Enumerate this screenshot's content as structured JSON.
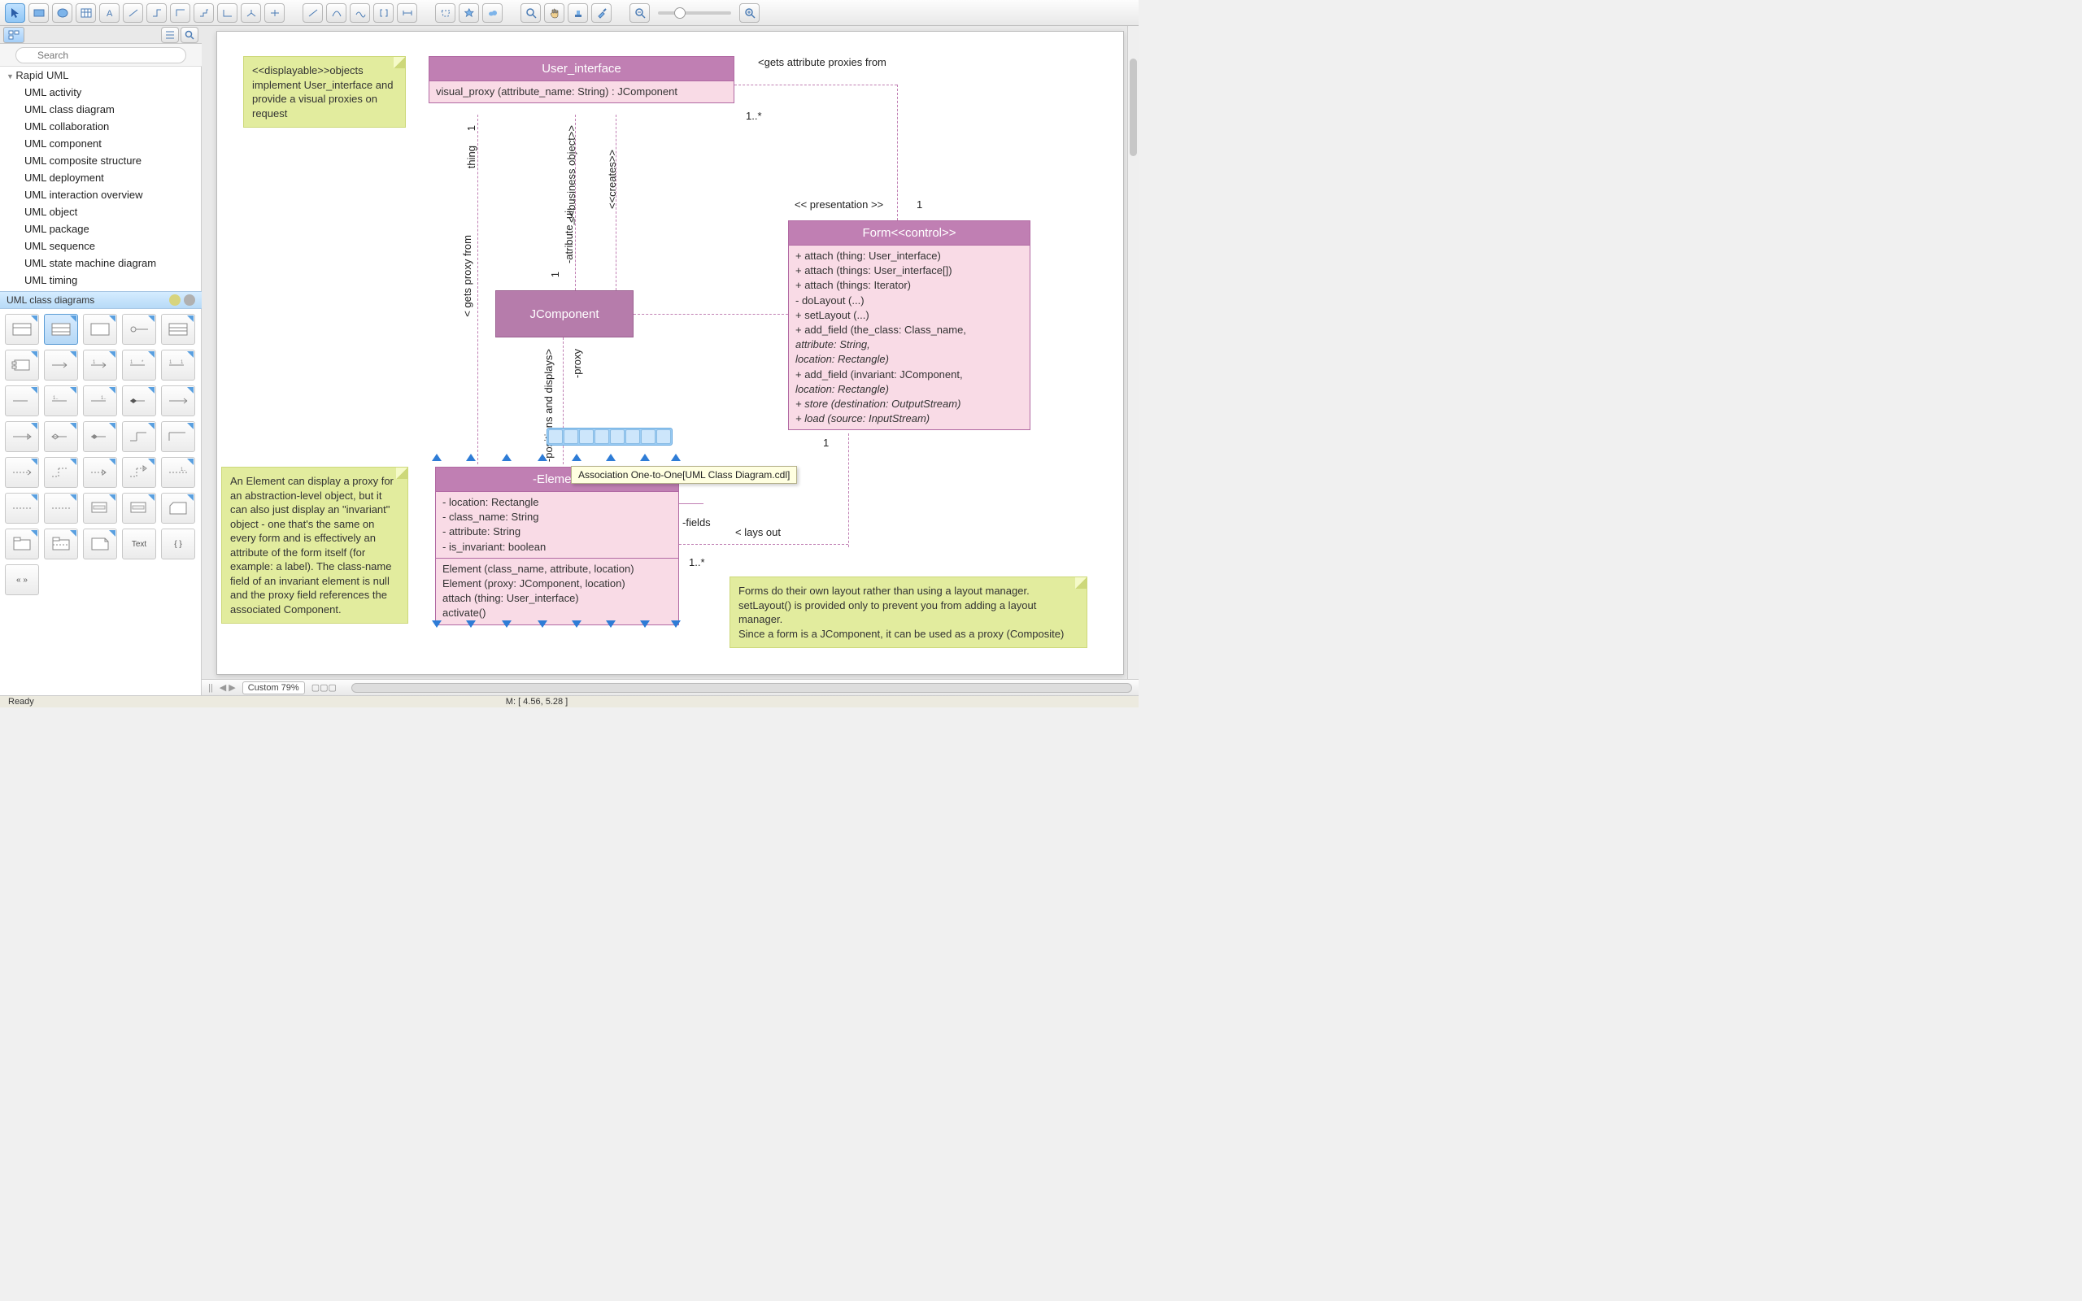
{
  "toolbar": {
    "icons": [
      "pointer",
      "rect",
      "ellipse",
      "table",
      "text",
      "connector-straight",
      "connector-angle",
      "connector-ortho",
      "connector-ortho2",
      "connector-step",
      "connector-tree",
      "connector-branch",
      "line",
      "arc",
      "curve",
      "bracket",
      "dimension",
      "polygon",
      "star",
      "cloud",
      "magnifier",
      "hand",
      "stamp",
      "dropper",
      "zoom-out",
      "zoom-in"
    ]
  },
  "search": {
    "placeholder": "Search"
  },
  "tree": {
    "header": "Rapid UML",
    "items": [
      "UML activity",
      "UML class diagram",
      "UML collaboration",
      "UML component",
      "UML composite structure",
      "UML deployment",
      "UML interaction overview",
      "UML object",
      "UML package",
      "UML sequence",
      "UML state machine diagram",
      "UML timing"
    ]
  },
  "palette": {
    "title": "UML class diagrams",
    "text_cells": [
      "Text",
      "{ }",
      "« »"
    ]
  },
  "canvas": {
    "note1": "<<displayable>>objects implement User_interface and provide a visual proxies on request",
    "note2": "An Element can display a proxy for an abstraction-level object, but it can also just display an \"invariant\" object - one that's the same on every form and is effectively an attribute of the form itself (for example: a label). The class-name field of an invariant element is null and the proxy field references the associated Component.",
    "note3": "Forms do their own layout rather than using a layout manager. setLayout() is provided only to prevent you from adding a layout manager.\nSince a form is a JComponent, it can be used as a proxy (Composite)",
    "user_interface": {
      "title": "User_interface",
      "op": "visual_proxy (attribute_name: String) : JComponent"
    },
    "jcomponent": "JComponent",
    "form": {
      "title": "Form<<control>>",
      "ops": [
        "+ attach (thing: User_interface)",
        "+ attach (things: User_interface[])",
        "+ attach (things: Iterator)",
        "- doLayout (...)",
        "+ setLayout (...)",
        "+ add_field (the_class: Class_name,",
        "                     attribute: String,",
        "                     location: Rectangle)",
        "+ add_field (invariant: JComponent,",
        "                     location: Rectangle)",
        "+ store (destination: OutputStream)",
        "+ load (source: InputStream)"
      ]
    },
    "element": {
      "title": "-Element",
      "attrs": [
        "- location: Rectangle",
        "- class_name: String",
        "- attribute: String",
        "- is_invariant: boolean"
      ],
      "ops": [
        "Element (class_name, attribute, location)",
        "Element (proxy: JComponent, location)",
        "attach (thing: User_interface)",
        "activate()"
      ]
    },
    "labels": {
      "gets_attr": "<gets attribute proxies from",
      "one_star_a": "1..*",
      "thing": "thing",
      "business": "<<business object>>",
      "creates": "<<creates>>",
      "one_a": "1",
      "gets_proxy": "< gets proxy from",
      "one_b": "1",
      "atribute": "-atribute_ui",
      "positions": "-positions and displays>",
      "proxy": "-proxy",
      "presentation": "<< presentation >>",
      "one_c": "1",
      "one_d": "1",
      "fields": "-fields",
      "lays_out": "< lays out",
      "one_star_b": "1..*"
    },
    "tooltip": "Association One-to-One[UML Class Diagram.cdl]"
  },
  "bottom": {
    "zoom": "Custom 79%",
    "coord": "M: [ 4.56, 5.28 ]",
    "status": "Ready"
  }
}
